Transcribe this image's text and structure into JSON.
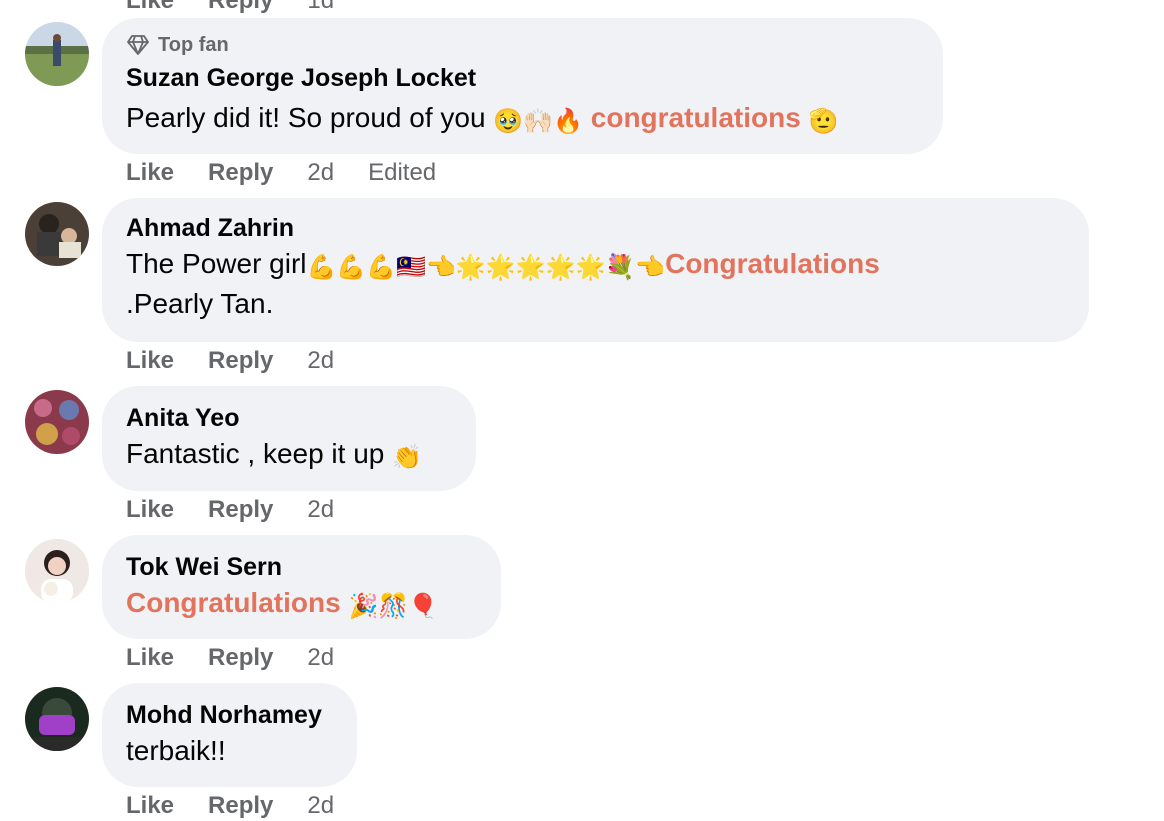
{
  "prev_actions": {
    "like": "Like",
    "reply": "Reply",
    "time": "1d"
  },
  "comments": [
    {
      "badge": "Top fan",
      "author": "Suzan George Joseph Locket",
      "text": "Pearly did it! So proud of you",
      "emoji1": "🥹🙌🏻🔥",
      "highlight": "congratulations",
      "emoji2": "🫡",
      "like": "Like",
      "reply": "Reply",
      "time": "2d",
      "edited": "Edited"
    },
    {
      "author": "Ahmad Zahrin",
      "text": "The Power girl",
      "emoji1": "💪💪💪🇲🇾👈🌟🌟🌟🌟🌟💐👈",
      "highlight": "Congratulations",
      "text2": ".Pearly Tan.",
      "like": "Like",
      "reply": "Reply",
      "time": "2d"
    },
    {
      "author": "Anita Yeo",
      "text": "Fantastic , keep it up",
      "emoji1": "👏",
      "like": "Like",
      "reply": "Reply",
      "time": "2d"
    },
    {
      "author": "Tok Wei Sern",
      "highlight": "Congratulations",
      "emoji1": "🎉🎊🎈",
      "like": "Like",
      "reply": "Reply",
      "time": "2d"
    },
    {
      "author": "Mohd Norhamey",
      "text": "terbaik!!",
      "like": "Like",
      "reply": "Reply",
      "time": "2d"
    }
  ]
}
